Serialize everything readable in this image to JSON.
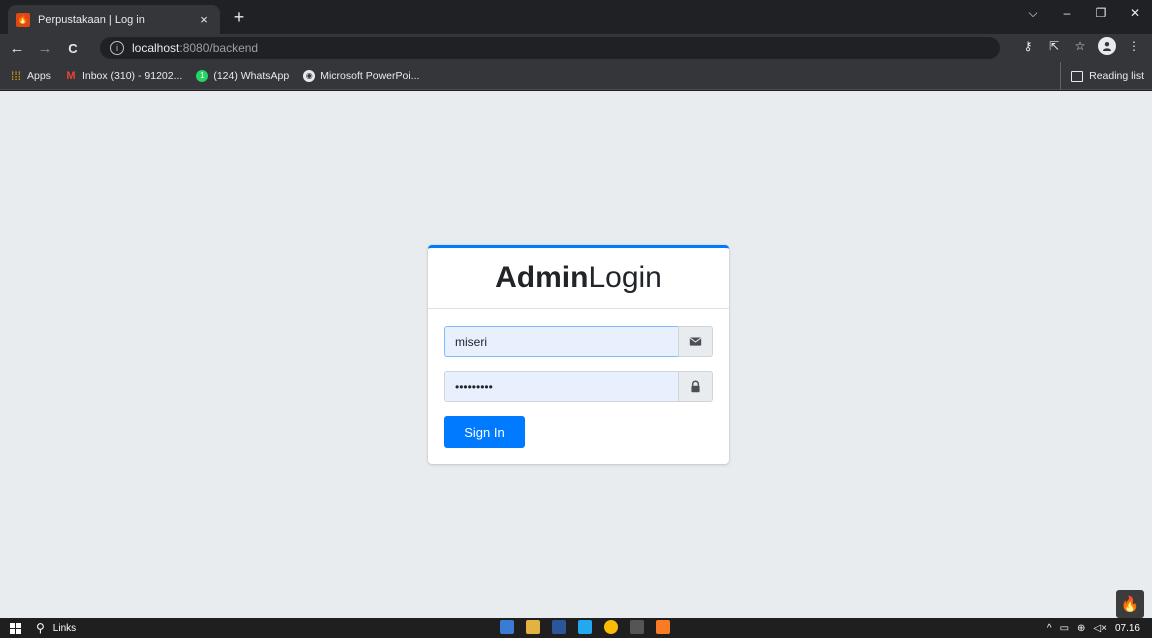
{
  "browser": {
    "tab": {
      "title": "Perpustakaan | Log in",
      "close": "×"
    },
    "new_tab": "+",
    "window_controls": {
      "dropdown": "⌵",
      "minimize": "–",
      "restore": "❐",
      "close": "✕"
    },
    "nav": {
      "back": "←",
      "forward": "→",
      "reload": "C"
    },
    "url": {
      "info_icon": "i",
      "host": "localhost",
      "rest": ":8080/backend"
    },
    "toolbar_icons": {
      "key": "⚷",
      "share": "⇱",
      "star": "☆",
      "menu": "⋮"
    }
  },
  "bookmarks": {
    "items": [
      {
        "label": "Apps",
        "icon": "apps-grid-icon"
      },
      {
        "label": "Inbox (310) - 91202...",
        "icon": "gmail-icon"
      },
      {
        "label": "(124) WhatsApp",
        "icon": "whatsapp-icon"
      },
      {
        "label": "Microsoft PowerPoi...",
        "icon": "globe-icon"
      }
    ],
    "reading_list": "Reading list"
  },
  "login": {
    "title_bold": "Admin",
    "title_rest": "Login",
    "username": {
      "value": "miseri",
      "icon": "envelope-icon"
    },
    "password": {
      "value": "•••••••••",
      "icon": "lock-icon"
    },
    "submit_label": "Sign In"
  },
  "taskbar": {
    "search_label": "Links",
    "tray_time": "07.16",
    "tray_chevron": "^"
  },
  "colors": {
    "primary": "#007bff",
    "page_bg": "#e9ecef",
    "chrome_dark": "#202124",
    "chrome_toolbar": "#35363a"
  }
}
